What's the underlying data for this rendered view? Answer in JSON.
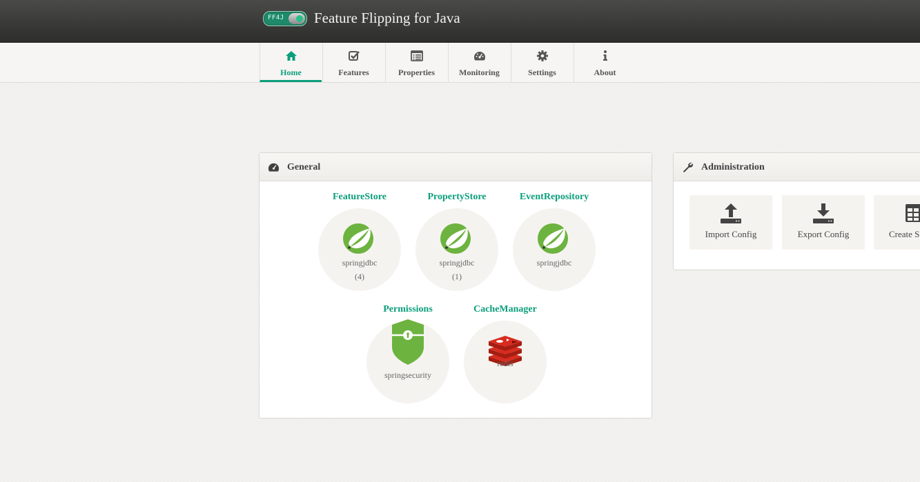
{
  "header": {
    "logo_text": "FF4J",
    "title": "Feature Flipping for Java"
  },
  "nav": {
    "tabs": [
      {
        "label": "Home",
        "icon": "home-icon",
        "active": true
      },
      {
        "label": "Features",
        "icon": "check-square-icon",
        "active": false
      },
      {
        "label": "Properties",
        "icon": "list-icon",
        "active": false
      },
      {
        "label": "Monitoring",
        "icon": "dashboard-icon",
        "active": false
      },
      {
        "label": "Settings",
        "icon": "gear-icon",
        "active": false
      },
      {
        "label": "About",
        "icon": "info-icon",
        "active": false
      }
    ]
  },
  "general": {
    "title": "General",
    "icon": "dashboard-icon",
    "stores": [
      {
        "name": "FeatureStore",
        "impl": "springjdbc",
        "count": "(4)",
        "icon": "spring-leaf-icon"
      },
      {
        "name": "PropertyStore",
        "impl": "springjdbc",
        "count": "(1)",
        "icon": "spring-leaf-icon"
      },
      {
        "name": "EventRepository",
        "impl": "springjdbc",
        "count": "",
        "icon": "spring-leaf-icon"
      },
      {
        "name": "Permissions",
        "impl": "springsecurity",
        "count": "",
        "icon": "shield-icon"
      },
      {
        "name": "CacheManager",
        "impl": "redis",
        "count": "",
        "icon": "redis-icon"
      }
    ]
  },
  "administration": {
    "title": "Administration",
    "icon": "wrench-icon",
    "buttons": [
      {
        "label": "Import Config",
        "icon": "upload-icon"
      },
      {
        "label": "Export Config",
        "icon": "download-icon"
      },
      {
        "label": "Create S",
        "icon": "table-icon"
      }
    ]
  },
  "colors": {
    "accent": "#0b9e7c",
    "spring_green": "#6db33f",
    "redis_red": "#d82c20"
  }
}
